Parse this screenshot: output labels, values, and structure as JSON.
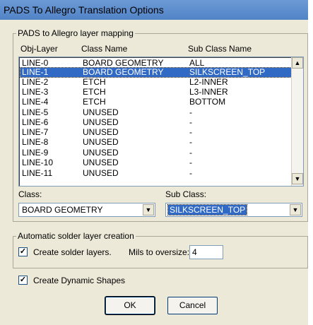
{
  "window": {
    "title": "PADS To Allegro Translation Options"
  },
  "mapping": {
    "group_label": "PADS to Allegro layer mapping",
    "columns": [
      "Obj-Layer",
      "Class Name",
      "Sub Class Name"
    ],
    "rows": [
      [
        "LINE-0",
        "BOARD GEOMETRY",
        "ALL"
      ],
      [
        "LINE-1",
        "BOARD GEOMETRY",
        "SILKSCREEN_TOP"
      ],
      [
        "LINE-2",
        "ETCH",
        "L2-INNER"
      ],
      [
        "LINE-3",
        "ETCH",
        "L3-INNER"
      ],
      [
        "LINE-4",
        "ETCH",
        "BOTTOM"
      ],
      [
        "LINE-5",
        "UNUSED",
        "-"
      ],
      [
        "LINE-6",
        "UNUSED",
        "-"
      ],
      [
        "LINE-7",
        "UNUSED",
        "-"
      ],
      [
        "LINE-8",
        "UNUSED",
        "-"
      ],
      [
        "LINE-9",
        "UNUSED",
        "-"
      ],
      [
        "LINE-10",
        "UNUSED",
        "-"
      ],
      [
        "LINE-11",
        "UNUSED",
        "-"
      ]
    ],
    "selected_row": "LINE-1",
    "scroll_up_icon": "triangle-up-icon",
    "scroll_down_icon": "triangle-down-icon",
    "class_label": "Class:",
    "class_value": "BOARD GEOMETRY",
    "subclass_label": "Sub Class:",
    "subclass_value": "SILKSCREEN_TOP"
  },
  "solder": {
    "group_label": "Automatic solder layer creation",
    "create_label": "Create solder layers.",
    "create_checked": true,
    "mils_label": "Mils to oversize:",
    "mils_value": "4"
  },
  "dynamic": {
    "label": "Create Dynamic Shapes",
    "checked": true
  },
  "buttons": {
    "ok": "OK",
    "cancel": "Cancel"
  },
  "colors": {
    "selection": "#316ac5",
    "titlebar": "#5b8bd0",
    "dialog": "#ece9d8"
  }
}
